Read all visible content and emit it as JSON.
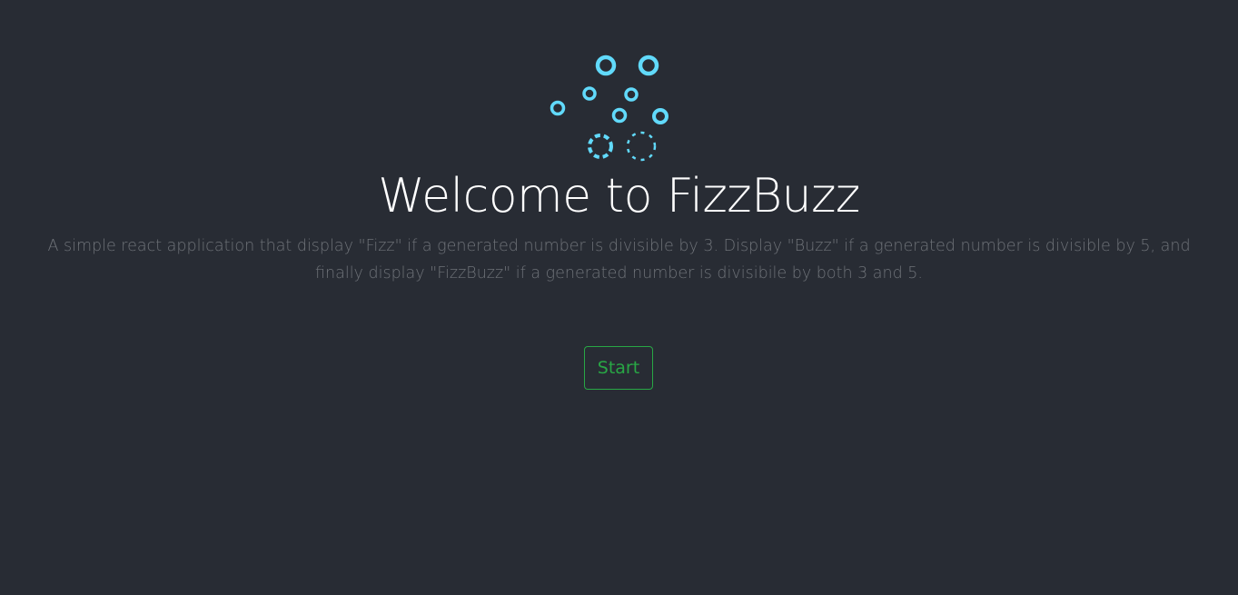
{
  "app": {
    "title": "Welcome to FizzBuzz",
    "description": "A simple react application that display \"Fizz\" if a generated number is divisible by 3. Display \"Buzz\" if a generated number is divisible by 5, and finally display \"FizzBuzz\" if a generated number is divisibile by both 3 and 5.",
    "start_label": "Start",
    "logo_icon": "bubbles-icon"
  },
  "colors": {
    "background": "#282c34",
    "title": "#ffffff",
    "description": "#6e7278",
    "accent": "#61dafb",
    "button": "#28a745"
  }
}
